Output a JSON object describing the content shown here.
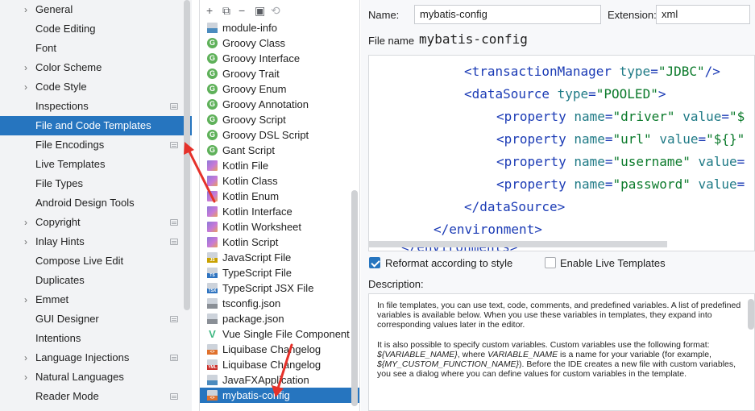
{
  "nav": {
    "items": [
      {
        "label": "General",
        "chevron": true,
        "badge": false
      },
      {
        "label": "Code Editing",
        "chevron": false,
        "badge": false
      },
      {
        "label": "Font",
        "chevron": false,
        "badge": false
      },
      {
        "label": "Color Scheme",
        "chevron": true,
        "badge": false
      },
      {
        "label": "Code Style",
        "chevron": true,
        "badge": false
      },
      {
        "label": "Inspections",
        "chevron": false,
        "badge": true
      },
      {
        "label": "File and Code Templates",
        "chevron": false,
        "badge": false,
        "selected": true
      },
      {
        "label": "File Encodings",
        "chevron": false,
        "badge": true
      },
      {
        "label": "Live Templates",
        "chevron": false,
        "badge": false
      },
      {
        "label": "File Types",
        "chevron": false,
        "badge": false
      },
      {
        "label": "Android Design Tools",
        "chevron": false,
        "badge": false
      },
      {
        "label": "Copyright",
        "chevron": true,
        "badge": true
      },
      {
        "label": "Inlay Hints",
        "chevron": true,
        "badge": true
      },
      {
        "label": "Compose Live Edit",
        "chevron": false,
        "badge": false
      },
      {
        "label": "Duplicates",
        "chevron": false,
        "badge": false
      },
      {
        "label": "Emmet",
        "chevron": true,
        "badge": false
      },
      {
        "label": "GUI Designer",
        "chevron": false,
        "badge": true
      },
      {
        "label": "Intentions",
        "chevron": false,
        "badge": false
      },
      {
        "label": "Language Injections",
        "chevron": true,
        "badge": true
      },
      {
        "label": "Natural Languages",
        "chevron": true,
        "badge": false
      },
      {
        "label": "Reader Mode",
        "chevron": false,
        "badge": true
      }
    ]
  },
  "toolbar": {
    "add": "+",
    "copy": "⧉",
    "remove": "−",
    "duplicate": "▣",
    "reset": "⟲"
  },
  "templates": {
    "items": [
      {
        "label": "module-info",
        "icon": "file"
      },
      {
        "label": "Groovy Class",
        "icon": "groovy"
      },
      {
        "label": "Groovy Interface",
        "icon": "groovy"
      },
      {
        "label": "Groovy Trait",
        "icon": "groovy"
      },
      {
        "label": "Groovy Enum",
        "icon": "groovy"
      },
      {
        "label": "Groovy Annotation",
        "icon": "groovy"
      },
      {
        "label": "Groovy Script",
        "icon": "groovy"
      },
      {
        "label": "Groovy DSL Script",
        "icon": "groovy"
      },
      {
        "label": "Gant Script",
        "icon": "groovy"
      },
      {
        "label": "Kotlin File",
        "icon": "kotlin"
      },
      {
        "label": "Kotlin Class",
        "icon": "kotlin"
      },
      {
        "label": "Kotlin Enum",
        "icon": "kotlin"
      },
      {
        "label": "Kotlin Interface",
        "icon": "kotlin"
      },
      {
        "label": "Kotlin Worksheet",
        "icon": "kotlin"
      },
      {
        "label": "Kotlin Script",
        "icon": "kotlin"
      },
      {
        "label": "JavaScript File",
        "icon": "js"
      },
      {
        "label": "TypeScript File",
        "icon": "ts"
      },
      {
        "label": "TypeScript JSX File",
        "icon": "tsx"
      },
      {
        "label": "tsconfig.json",
        "icon": "json"
      },
      {
        "label": "package.json",
        "icon": "json"
      },
      {
        "label": "Vue Single File Component",
        "icon": "vue"
      },
      {
        "label": "Liquibase Changelog",
        "icon": "xml"
      },
      {
        "label": "Liquibase Changelog",
        "icon": "yml"
      },
      {
        "label": "JavaFXApplication",
        "icon": "file"
      },
      {
        "label": "mybatis-config",
        "icon": "xml",
        "selected": true
      }
    ]
  },
  "editor": {
    "name_label": "Name:",
    "name_value": "mybatis-config",
    "extension_label": "Extension:",
    "extension_value": "xml",
    "filename_label": "File name:",
    "filename_value": "mybatis-config",
    "code_lines": [
      [
        {
          "t": "<transactionManager ",
          "c": "tag-b"
        },
        {
          "t": "type",
          "c": "attr-n"
        },
        {
          "t": "=",
          "c": "punct"
        },
        {
          "t": "\"JDBC\"",
          "c": "attr-v"
        },
        {
          "t": "/>",
          "c": "tag-b"
        }
      ],
      [
        {
          "t": "<dataSource ",
          "c": "tag-b"
        },
        {
          "t": "type",
          "c": "attr-n"
        },
        {
          "t": "=",
          "c": "punct"
        },
        {
          "t": "\"POOLED\"",
          "c": "attr-v"
        },
        {
          "t": ">",
          "c": "tag-b"
        }
      ],
      [
        {
          "t": "<property ",
          "c": "tag-b"
        },
        {
          "t": "name",
          "c": "attr-n"
        },
        {
          "t": "=",
          "c": "punct"
        },
        {
          "t": "\"driver\"",
          "c": "attr-v"
        },
        {
          "t": " ",
          "c": "tag-b"
        },
        {
          "t": "value",
          "c": "attr-n"
        },
        {
          "t": "=",
          "c": "punct"
        },
        {
          "t": "\"$",
          "c": "attr-v"
        }
      ],
      [
        {
          "t": "<property ",
          "c": "tag-b"
        },
        {
          "t": "name",
          "c": "attr-n"
        },
        {
          "t": "=",
          "c": "punct"
        },
        {
          "t": "\"url\"",
          "c": "attr-v"
        },
        {
          "t": " ",
          "c": "tag-b"
        },
        {
          "t": "value",
          "c": "attr-n"
        },
        {
          "t": "=",
          "c": "punct"
        },
        {
          "t": "\"${}\"",
          "c": "attr-v"
        }
      ],
      [
        {
          "t": "<property ",
          "c": "tag-b"
        },
        {
          "t": "name",
          "c": "attr-n"
        },
        {
          "t": "=",
          "c": "punct"
        },
        {
          "t": "\"username\"",
          "c": "attr-v"
        },
        {
          "t": " ",
          "c": "tag-b"
        },
        {
          "t": "value",
          "c": "attr-n"
        },
        {
          "t": "=",
          "c": "punct"
        }
      ],
      [
        {
          "t": "<property ",
          "c": "tag-b"
        },
        {
          "t": "name",
          "c": "attr-n"
        },
        {
          "t": "=",
          "c": "punct"
        },
        {
          "t": "\"password\"",
          "c": "attr-v"
        },
        {
          "t": " ",
          "c": "tag-b"
        },
        {
          "t": "value",
          "c": "attr-n"
        },
        {
          "t": "=",
          "c": "punct"
        }
      ],
      [
        {
          "t": "</dataSource>",
          "c": "tag-b"
        }
      ],
      [
        {
          "t": "</environment>",
          "c": "tag-b"
        }
      ],
      [
        {
          "t": "</environments>",
          "c": "tag-b"
        }
      ]
    ],
    "reformat_label": "Reformat according to style",
    "reformat_checked": true,
    "live_templates_label": "Enable Live Templates",
    "live_templates_checked": false,
    "description_label": "Description:",
    "description_p1": "In file templates, you can use text, code, comments, and predefined variables. A list of predefined variables is available below. When you use these variables in templates, they expand into corresponding values later in the editor.",
    "description_p2_a": "It is also possible to specify custom variables. Custom variables use the following format: ",
    "description_p2_var1": "${VARIABLE_NAME}",
    "description_p2_b": ", where ",
    "description_p2_var2": "VARIABLE_NAME",
    "description_p2_c": " is a name for your variable (for example, ",
    "description_p2_var3": "${MY_CUSTOM_FUNCTION_NAME}",
    "description_p2_d": "). Before the IDE creates a new file with custom variables, you see a dialog where you can define values for custom variables in the template."
  },
  "colors": {
    "selection": "#2675bf",
    "annotation_arrow": "#e5312a"
  }
}
